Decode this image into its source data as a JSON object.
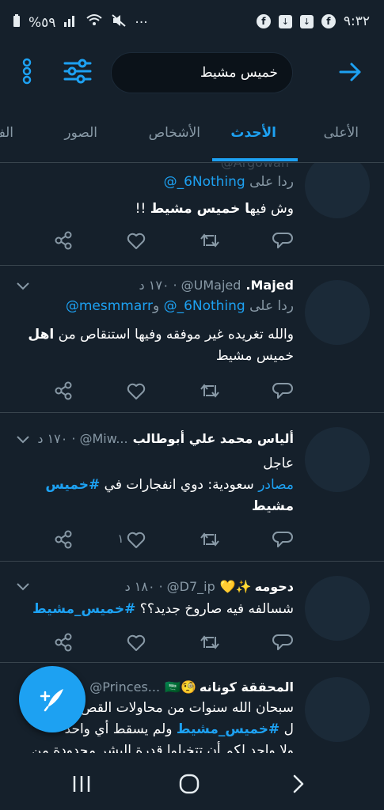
{
  "status_bar": {
    "battery": "%٥٩",
    "time": "٩:٣٢",
    "more": "···"
  },
  "search": {
    "value": "خميس مشيط"
  },
  "tabs": [
    {
      "label": "الأعلى"
    },
    {
      "label": "الأحدث"
    },
    {
      "label": "الأشخاص"
    },
    {
      "label": "الصور"
    },
    {
      "label": "الف"
    }
  ],
  "tweets": [
    {
      "partial_header": "@Argowan",
      "reply_prefix": "ردا على",
      "reply_to": "@_6Nothing",
      "text_pre": "وش فيه",
      "text_hl": "ا خميس مشيط",
      "text_post": " !!",
      "reply_count": "",
      "retweet_count": "",
      "like_count": ""
    },
    {
      "name": "Majed.",
      "handle": "@UMajed",
      "time": "١٧٠ د",
      "reply_prefix": "ردا على",
      "reply_to": "@_6Nothing",
      "reply_and": " و",
      "reply_to2": "@mesmmarr",
      "text_pre": "والله تغريده غير موفقه وفيها استنقاص من ",
      "text_hl": "اهل",
      "text_post": " خميس مشيط",
      "like_count": ""
    },
    {
      "name": "ألياس محمد علي أبوطالب",
      "handle": "@Miw...",
      "time": "١٧٠ د",
      "line1": "عاجل",
      "link_word": "مصادر",
      "line2_rest": " سعودية: دوي انفجارات في ",
      "hashtag": "#خميس",
      "line3": "مشيط",
      "like_count": "١"
    },
    {
      "name": "دحومه",
      "emoji": "✨💛",
      "handle": "@D7_ip",
      "time": "١٨٠ د",
      "text": "شسالفه فيه صاروخ جديد؟؟ ",
      "hashtag": "#خميس_مشيط"
    },
    {
      "name": "المحققة كونانه",
      "emoji": "🧐🇸🇦",
      "handle": "@Princes...",
      "line1": "سبحان الله سنوات من محاولات القص",
      "line2_pre": "ل ",
      "hashtag": "#خميس_مشيط",
      "line2_post": " ولم يسقط أي واحد",
      "line3": "ولا واحد لكم أن تتخيلوا قدرة البشر محدودة من"
    }
  ],
  "colors": {
    "background": "#15202b",
    "accent": "#1da1f2",
    "muted": "#8899a6",
    "divider": "#38444d"
  }
}
